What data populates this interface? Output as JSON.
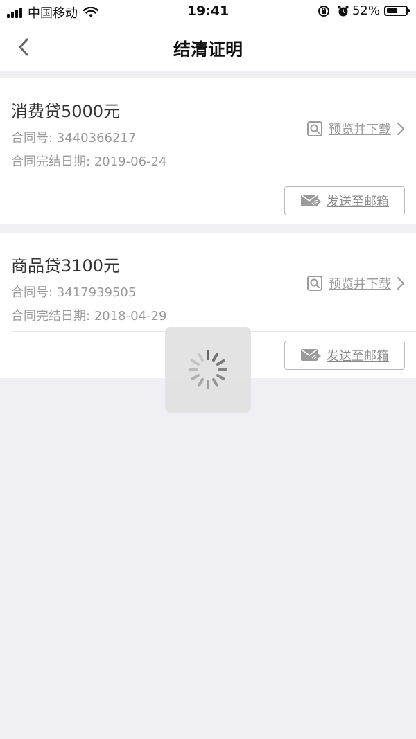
{
  "status_bar": {
    "carrier": "中国移动",
    "time": "19:41",
    "battery_percent": "52%",
    "battery_level": 0.52
  },
  "nav": {
    "title": "结清证明",
    "back_icon": "chevron-left-icon"
  },
  "loans": [
    {
      "title": "消费贷5000元",
      "contract_label": "合同号:",
      "contract_number": "3440366217",
      "date_label": "合同完结日期:",
      "date": "2019-06-24",
      "preview_label": "预览并下载",
      "email_label": "发送至邮箱"
    },
    {
      "title": "商品贷3100元",
      "contract_label": "合同号:",
      "contract_number": "3417939505",
      "date_label": "合同完结日期:",
      "date": "2018-04-29",
      "preview_label": "预览并下载",
      "email_label": "发送至邮箱"
    }
  ],
  "colors": {
    "background": "#efeff4",
    "card": "#ffffff",
    "muted_text": "#9a9a9a",
    "primary_text": "#333333"
  }
}
